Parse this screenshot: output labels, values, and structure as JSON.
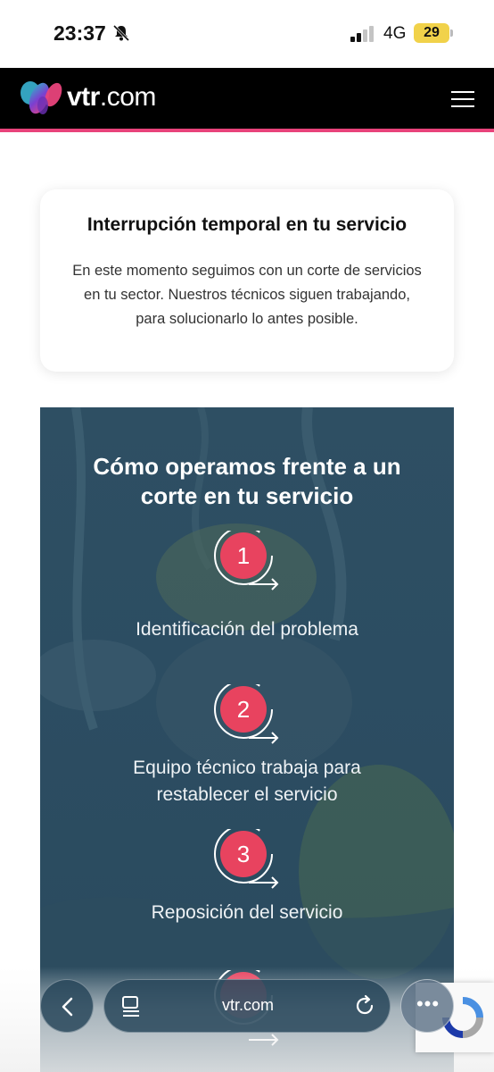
{
  "status_bar": {
    "time": "23:37",
    "network": "4G",
    "battery": "29",
    "icons": [
      "bell-muted-icon",
      "signal-icon",
      "battery-icon"
    ]
  },
  "header": {
    "logo_bold": "vtr",
    "logo_rest": ".com",
    "menu_icon": "hamburger-icon",
    "accent_color": "#e8437b"
  },
  "notice": {
    "title": "Interrupción temporal en tu servicio",
    "body": "En este momento seguimos con un corte de servicios en tu sector. Nuestros técnicos siguen trabajando, para solucionarlo lo antes posible."
  },
  "banner": {
    "title_line1": "Cómo operamos frente a un",
    "title_line2": "corte en tu servicio",
    "step_color": "#e8435f",
    "steps": [
      {
        "number": "1",
        "line1": "Identificación del problema",
        "line2": ""
      },
      {
        "number": "2",
        "line1": "Equipo técnico trabaja para",
        "line2": "restablecer el servicio"
      },
      {
        "number": "3",
        "line1": "Reposición del servicio",
        "line2": ""
      },
      {
        "number": "4",
        "line1": "",
        "line2": ""
      }
    ]
  },
  "browser": {
    "url": "vtr.com",
    "more_label": "•••",
    "icons": [
      "back-icon",
      "tabs-icon",
      "reload-icon",
      "more-icon"
    ]
  }
}
